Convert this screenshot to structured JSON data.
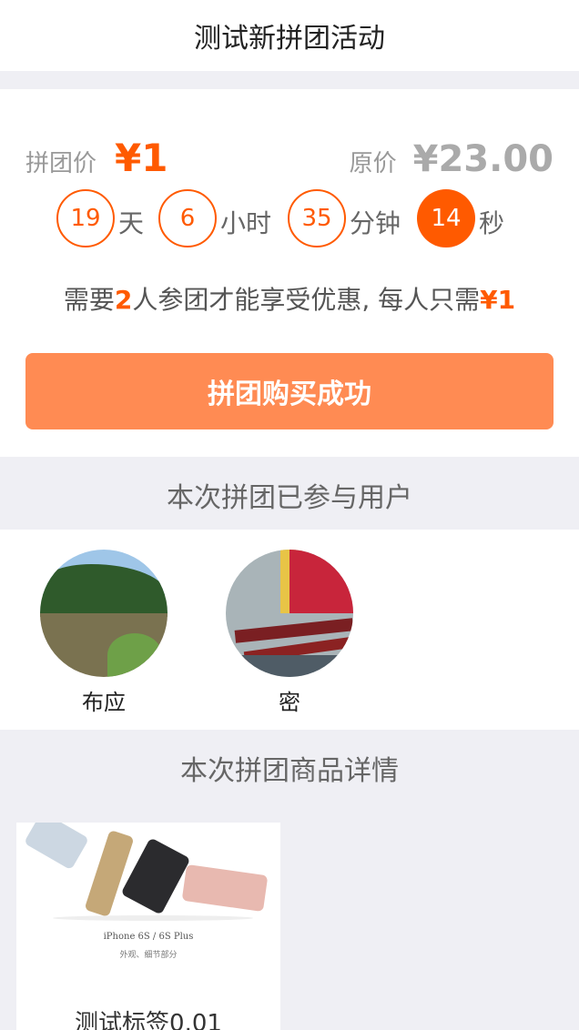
{
  "navbar": {
    "title": "测试新拼团活动"
  },
  "price": {
    "group_label": "拼团价",
    "group_value": "¥1",
    "original_label": "原价",
    "original_value": "¥23.00"
  },
  "countdown": {
    "days": "19",
    "days_unit": "天",
    "hours": "6",
    "hours_unit": "小时",
    "minutes": "35",
    "minutes_unit": "分钟",
    "seconds": "14",
    "seconds_unit": "秒"
  },
  "notice": {
    "prefix": "需要",
    "count": "2",
    "middle": "人参团才能享受优惠, 每人只需",
    "price": "¥1"
  },
  "buy_button": {
    "label": "拼团购买成功"
  },
  "members_section": {
    "title": "本次拼团已参与用户",
    "members": [
      {
        "name": "布应"
      },
      {
        "name": "密"
      }
    ]
  },
  "product_section": {
    "title": "本次拼团商品详情",
    "product": {
      "image_caption": "iPhone 6S / 6S Plus",
      "image_subcaption": "外观、细节部分",
      "name": "测试标签0.01"
    }
  },
  "colors": {
    "accent": "#ff5a00",
    "button": "#ff8b53",
    "background": "#efeff4"
  }
}
